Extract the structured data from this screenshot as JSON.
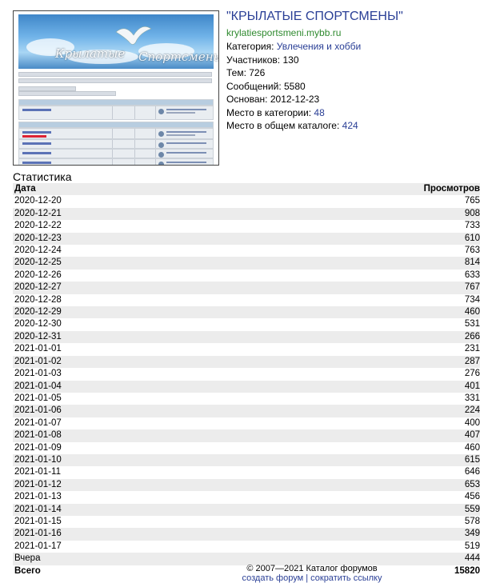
{
  "forum": {
    "title": "\"КРЫЛАТЫЕ СПОРТСМЕНЫ\"",
    "domain": "krylatiesportsmeni.mybb.ru",
    "category_label": "Категория: ",
    "category_value": "Увлечения и хобби",
    "members": "Участников: 130",
    "topics": "Тем: 726",
    "posts": "Сообщений: 5580",
    "founded": "Основан: 2012-12-23",
    "rank_category_label": "Место в категории: ",
    "rank_category_value": "48",
    "rank_overall_label": "Место в общем каталоге: ",
    "rank_overall_value": "424"
  },
  "stats": {
    "title": "Статистика",
    "col_date": "Дата",
    "col_views": "Просмотров",
    "rows": [
      {
        "date": "2020-12-20",
        "views": "765"
      },
      {
        "date": "2020-12-21",
        "views": "908"
      },
      {
        "date": "2020-12-22",
        "views": "733"
      },
      {
        "date": "2020-12-23",
        "views": "610"
      },
      {
        "date": "2020-12-24",
        "views": "763"
      },
      {
        "date": "2020-12-25",
        "views": "814"
      },
      {
        "date": "2020-12-26",
        "views": "633"
      },
      {
        "date": "2020-12-27",
        "views": "767"
      },
      {
        "date": "2020-12-28",
        "views": "734"
      },
      {
        "date": "2020-12-29",
        "views": "460"
      },
      {
        "date": "2020-12-30",
        "views": "531"
      },
      {
        "date": "2020-12-31",
        "views": "266"
      },
      {
        "date": "2021-01-01",
        "views": "231"
      },
      {
        "date": "2021-01-02",
        "views": "287"
      },
      {
        "date": "2021-01-03",
        "views": "276"
      },
      {
        "date": "2021-01-04",
        "views": "401"
      },
      {
        "date": "2021-01-05",
        "views": "331"
      },
      {
        "date": "2021-01-06",
        "views": "224"
      },
      {
        "date": "2021-01-07",
        "views": "400"
      },
      {
        "date": "2021-01-08",
        "views": "407"
      },
      {
        "date": "2021-01-09",
        "views": "460"
      },
      {
        "date": "2021-01-10",
        "views": "615"
      },
      {
        "date": "2021-01-11",
        "views": "646"
      },
      {
        "date": "2021-01-12",
        "views": "653"
      },
      {
        "date": "2021-01-13",
        "views": "456"
      },
      {
        "date": "2021-01-14",
        "views": "559"
      },
      {
        "date": "2021-01-15",
        "views": "578"
      },
      {
        "date": "2021-01-16",
        "views": "349"
      },
      {
        "date": "2021-01-17",
        "views": "519"
      }
    ],
    "yesterday_label": "Вчера",
    "yesterday_value": "444",
    "total_label": "Всего",
    "total_value": "15820"
  },
  "footer": {
    "copyright": "© 2007—2021 Каталог форумов",
    "create_link": "создать форум",
    "separator": "|",
    "shorten_link": "сократить ссылку"
  }
}
